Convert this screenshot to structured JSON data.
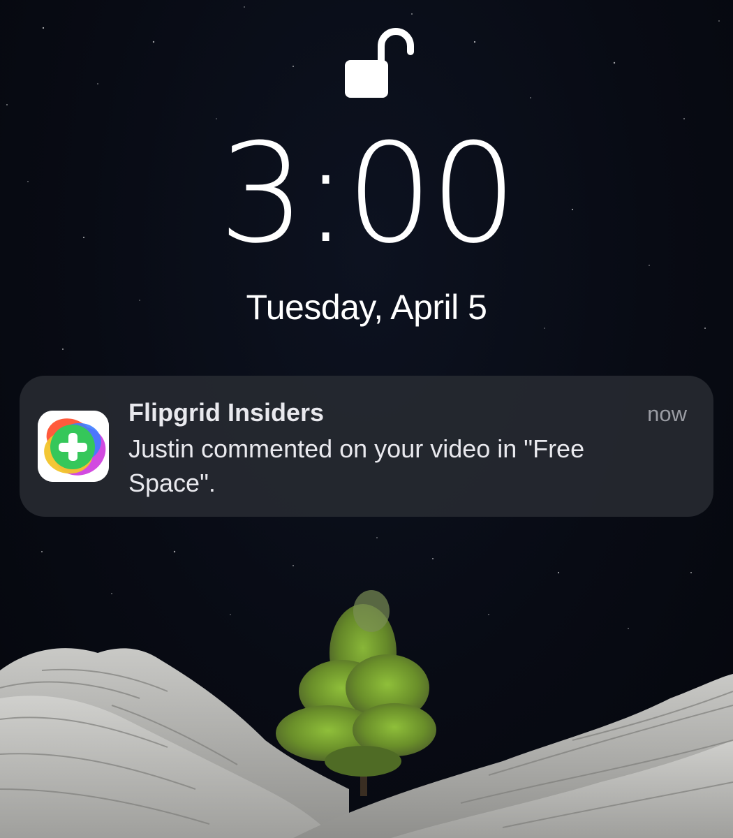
{
  "lockscreen": {
    "lock_icon": "unlocked-padlock-icon",
    "time": "3:00",
    "date": "Tuesday, April 5"
  },
  "notification": {
    "app_icon": "flipgrid-app-icon",
    "app_name": "Flipgrid Insiders",
    "timestamp": "now",
    "message": "Justin commented on your video in \"Free Space\"."
  },
  "wallpaper": {
    "description_icon": "night-sky-tree-rock-wallpaper",
    "colors": {
      "sky": "#080b14",
      "rock": "#b9b9b6",
      "tree": "#6f9a2c"
    }
  }
}
